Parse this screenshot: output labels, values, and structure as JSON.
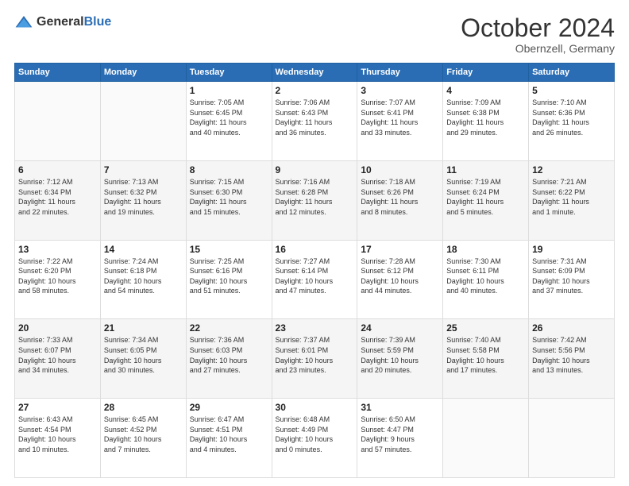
{
  "header": {
    "logo_general": "General",
    "logo_blue": "Blue",
    "month_title": "October 2024",
    "subtitle": "Obernzell, Germany"
  },
  "days_of_week": [
    "Sunday",
    "Monday",
    "Tuesday",
    "Wednesday",
    "Thursday",
    "Friday",
    "Saturday"
  ],
  "weeks": [
    [
      {
        "day": "",
        "info": ""
      },
      {
        "day": "",
        "info": ""
      },
      {
        "day": "1",
        "info": "Sunrise: 7:05 AM\nSunset: 6:45 PM\nDaylight: 11 hours\nand 40 minutes."
      },
      {
        "day": "2",
        "info": "Sunrise: 7:06 AM\nSunset: 6:43 PM\nDaylight: 11 hours\nand 36 minutes."
      },
      {
        "day": "3",
        "info": "Sunrise: 7:07 AM\nSunset: 6:41 PM\nDaylight: 11 hours\nand 33 minutes."
      },
      {
        "day": "4",
        "info": "Sunrise: 7:09 AM\nSunset: 6:38 PM\nDaylight: 11 hours\nand 29 minutes."
      },
      {
        "day": "5",
        "info": "Sunrise: 7:10 AM\nSunset: 6:36 PM\nDaylight: 11 hours\nand 26 minutes."
      }
    ],
    [
      {
        "day": "6",
        "info": "Sunrise: 7:12 AM\nSunset: 6:34 PM\nDaylight: 11 hours\nand 22 minutes."
      },
      {
        "day": "7",
        "info": "Sunrise: 7:13 AM\nSunset: 6:32 PM\nDaylight: 11 hours\nand 19 minutes."
      },
      {
        "day": "8",
        "info": "Sunrise: 7:15 AM\nSunset: 6:30 PM\nDaylight: 11 hours\nand 15 minutes."
      },
      {
        "day": "9",
        "info": "Sunrise: 7:16 AM\nSunset: 6:28 PM\nDaylight: 11 hours\nand 12 minutes."
      },
      {
        "day": "10",
        "info": "Sunrise: 7:18 AM\nSunset: 6:26 PM\nDaylight: 11 hours\nand 8 minutes."
      },
      {
        "day": "11",
        "info": "Sunrise: 7:19 AM\nSunset: 6:24 PM\nDaylight: 11 hours\nand 5 minutes."
      },
      {
        "day": "12",
        "info": "Sunrise: 7:21 AM\nSunset: 6:22 PM\nDaylight: 11 hours\nand 1 minute."
      }
    ],
    [
      {
        "day": "13",
        "info": "Sunrise: 7:22 AM\nSunset: 6:20 PM\nDaylight: 10 hours\nand 58 minutes."
      },
      {
        "day": "14",
        "info": "Sunrise: 7:24 AM\nSunset: 6:18 PM\nDaylight: 10 hours\nand 54 minutes."
      },
      {
        "day": "15",
        "info": "Sunrise: 7:25 AM\nSunset: 6:16 PM\nDaylight: 10 hours\nand 51 minutes."
      },
      {
        "day": "16",
        "info": "Sunrise: 7:27 AM\nSunset: 6:14 PM\nDaylight: 10 hours\nand 47 minutes."
      },
      {
        "day": "17",
        "info": "Sunrise: 7:28 AM\nSunset: 6:12 PM\nDaylight: 10 hours\nand 44 minutes."
      },
      {
        "day": "18",
        "info": "Sunrise: 7:30 AM\nSunset: 6:11 PM\nDaylight: 10 hours\nand 40 minutes."
      },
      {
        "day": "19",
        "info": "Sunrise: 7:31 AM\nSunset: 6:09 PM\nDaylight: 10 hours\nand 37 minutes."
      }
    ],
    [
      {
        "day": "20",
        "info": "Sunrise: 7:33 AM\nSunset: 6:07 PM\nDaylight: 10 hours\nand 34 minutes."
      },
      {
        "day": "21",
        "info": "Sunrise: 7:34 AM\nSunset: 6:05 PM\nDaylight: 10 hours\nand 30 minutes."
      },
      {
        "day": "22",
        "info": "Sunrise: 7:36 AM\nSunset: 6:03 PM\nDaylight: 10 hours\nand 27 minutes."
      },
      {
        "day": "23",
        "info": "Sunrise: 7:37 AM\nSunset: 6:01 PM\nDaylight: 10 hours\nand 23 minutes."
      },
      {
        "day": "24",
        "info": "Sunrise: 7:39 AM\nSunset: 5:59 PM\nDaylight: 10 hours\nand 20 minutes."
      },
      {
        "day": "25",
        "info": "Sunrise: 7:40 AM\nSunset: 5:58 PM\nDaylight: 10 hours\nand 17 minutes."
      },
      {
        "day": "26",
        "info": "Sunrise: 7:42 AM\nSunset: 5:56 PM\nDaylight: 10 hours\nand 13 minutes."
      }
    ],
    [
      {
        "day": "27",
        "info": "Sunrise: 6:43 AM\nSunset: 4:54 PM\nDaylight: 10 hours\nand 10 minutes."
      },
      {
        "day": "28",
        "info": "Sunrise: 6:45 AM\nSunset: 4:52 PM\nDaylight: 10 hours\nand 7 minutes."
      },
      {
        "day": "29",
        "info": "Sunrise: 6:47 AM\nSunset: 4:51 PM\nDaylight: 10 hours\nand 4 minutes."
      },
      {
        "day": "30",
        "info": "Sunrise: 6:48 AM\nSunset: 4:49 PM\nDaylight: 10 hours\nand 0 minutes."
      },
      {
        "day": "31",
        "info": "Sunrise: 6:50 AM\nSunset: 4:47 PM\nDaylight: 9 hours\nand 57 minutes."
      },
      {
        "day": "",
        "info": ""
      },
      {
        "day": "",
        "info": ""
      }
    ]
  ]
}
